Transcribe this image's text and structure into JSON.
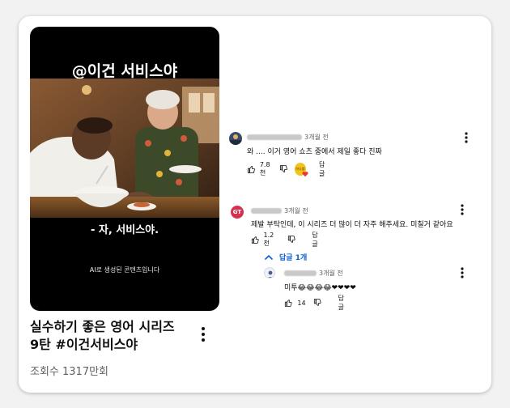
{
  "short": {
    "top_text": "@이건 서비스야",
    "subtitle": "- 자, 서비스야.",
    "ai_notice": "AI로 생성된 콘텐츠입니다"
  },
  "video": {
    "title_line1": "실수하기 좋은 영어 시리즈",
    "title_line2": "9탄 #이건서비스야",
    "views": "조회수 1317만회"
  },
  "comments": [
    {
      "time": "3개월 전",
      "text": "와 .... 이거 영어 쇼츠 중에서 제일 좋다 진짜",
      "likes": "7.8천",
      "reply_label": "답글",
      "creator_badge": "야나쌤"
    },
    {
      "avatar_initials": "GT",
      "time": "3개월 전",
      "text": "제발 부탁인데, 이 시리즈 더 많이 더 자주 해주세요. 미칠거 같아요",
      "likes": "1.2천",
      "reply_label": "답글",
      "replies_toggle": "답글 1개"
    }
  ],
  "reply": {
    "time": "3개월 전",
    "text": "미투😂😂😂😂❤❤❤❤",
    "likes": "14",
    "reply_label": "답글"
  },
  "colors": {
    "link_blue": "#065fd4",
    "gt_avatar": "#d5304f",
    "heart": "#e53935"
  }
}
